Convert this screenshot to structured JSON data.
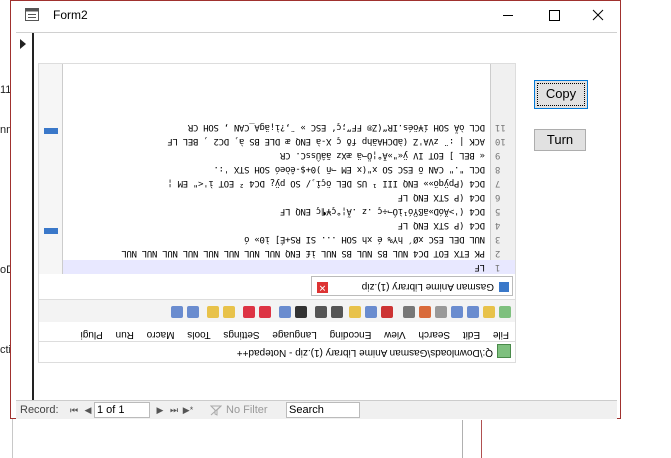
{
  "window": {
    "title": "Form2",
    "minimize_label": "",
    "maximize_label": "",
    "close_label": ""
  },
  "background_snippets": [
    "11",
    "nm",
    "oD",
    "ctic"
  ],
  "buttons": {
    "copy_label": "Copy",
    "turn_label": "Turn"
  },
  "navigator": {
    "record_label": "Record:",
    "position": "1 of 1",
    "filter_label": "No Filter",
    "search_label": "Search"
  },
  "embedded_image": {
    "orientation": "rotated 180 degrees",
    "title": "Q:\\Downloads\\Gasman Anime Library (1).zip - Notepad++",
    "menu": [
      "File",
      "Edit",
      "Search",
      "View",
      "Encoding",
      "Language",
      "Settings",
      "Tools",
      "Macro",
      "Run",
      "Plugi"
    ],
    "tab": "Gasman Anime Library (1).zip",
    "lines": [
      {
        "num": "1",
        "text": "LF"
      },
      {
        "num": "2",
        "text": "PK ETX EOT DC4 NUL BS NUL BS NUL ì£ ENQ NUL NUL NUL NUL NUL NUL NUL NUL"
      },
      {
        "num": "3",
        "text": "NUL DEL ESC  xØ´ hY% é xh SOH ...  SI  RS+É] ì0» ó"
      },
      {
        "num": "4",
        "text": "DC4 (P STX ENQ LF"
      },
      {
        "num": "5",
        "text": "DC4 ('>ÄóD»äßŸó¹ìÓ¬÷ç .z   .Ã¦°ç¥¶ç ENQ LF"
      },
      {
        "num": "6",
        "text": "DC4 (P STX ENQ LF"
      },
      {
        "num": "7",
        "text": "DC4 (Ppÿqö»» ENQ III ¹ US DEL öçî¸/ SO pÿ¿ DC4 ² EOT ì'<\" EM ¦"
      },
      {
        "num": "8",
        "text": "DCL \".\" CAN õ ESC SO x\"(x EM ¬ñ )0+$-êòeó SOH STX ':."
      },
      {
        "num": "9",
        "text": "« BEL ] EOT IV  ÿ«\"»Ä°¦Ö¬ä æXz  ãâÛssC.  CR"
      },
      {
        "num": "10",
        "text": "ACK | :¨  zVA'Z (àDCHAähp fð ç X-à ENQ æ DLE BS à¸ DC2 ¸ BEL LF"
      },
      {
        "num": "11",
        "text": "DCL òÃ SOH í¥öés.IR“(Z® FF”;ç‘ ESC » ¨,?ì¡ägA_CAN , SOH CR"
      }
    ]
  }
}
